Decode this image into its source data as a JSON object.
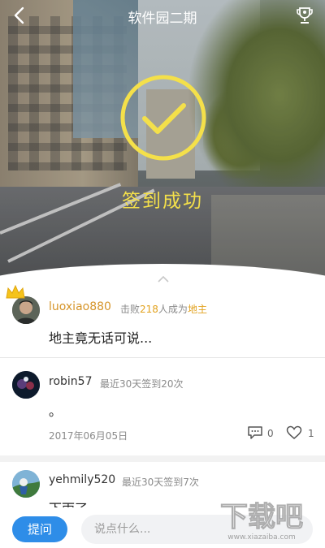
{
  "nav": {
    "title": "软件园二期",
    "back_icon": "chevron-left-icon",
    "trophy_icon": "trophy-icon"
  },
  "hero": {
    "success_text": "签到成功",
    "check_icon": "check-circle-icon",
    "accent_color": "#f4e04a"
  },
  "entries": [
    {
      "username": "luoxiao880",
      "meta_prefix": "击败",
      "meta_number": "218",
      "meta_mid": "人成为",
      "meta_title": "地主",
      "content": "地主竟无话可说...",
      "crown_icon": "crown-icon"
    },
    {
      "username": "robin57",
      "meta": "最近30天签到20次",
      "content": "。",
      "date": "2017年06月05日",
      "comment_count": "0",
      "like_count": "1"
    },
    {
      "username": "yehmily520",
      "meta": "最近30天签到7次",
      "content": "下雨了"
    }
  ],
  "bottom": {
    "ask_label": "提问",
    "input_placeholder": "说点什么..."
  },
  "watermark": {
    "text": "下载吧",
    "url": "www.xiazaiba.com"
  },
  "colors": {
    "link_blue": "#2e8de8",
    "highlight": "#e2a21e",
    "username_gold": "#d6952a"
  }
}
